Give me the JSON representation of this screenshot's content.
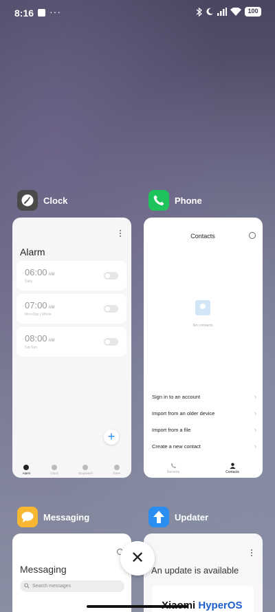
{
  "status_bar": {
    "time": "8:16",
    "more": "···",
    "battery": "100",
    "icons": [
      "bluetooth-icon",
      "moon-icon",
      "signal-icon",
      "wifi-icon",
      "battery-icon"
    ]
  },
  "apps": {
    "clock": {
      "name": "Clock",
      "icon_color": "#4a4a4a",
      "screen_title": "Alarm",
      "alarms": [
        {
          "time": "06:00",
          "ampm": "AM",
          "sub": "Daily"
        },
        {
          "time": "07:00",
          "ampm": "AM",
          "sub": "Mon-Day | Whole"
        },
        {
          "time": "08:00",
          "ampm": "AM",
          "sub": "Sat-Sun"
        }
      ],
      "add": "+",
      "nav": [
        "Alarm",
        "Clock",
        "Stopwatch",
        "Timer"
      ]
    },
    "phone": {
      "name": "Phone",
      "icon_color": "#1fc35b",
      "screen_title": "Contacts",
      "empty_text": "No contacts",
      "menu": [
        "Sign in to an account",
        "Import from an older device",
        "Import from a file",
        "Create a new contact"
      ],
      "nav": [
        "Recents",
        "Contacts"
      ]
    },
    "messaging": {
      "name": "Messaging",
      "icon_color": "#f7b733",
      "screen_title": "Messaging",
      "search_placeholder": "Search messages"
    },
    "updater": {
      "name": "Updater",
      "icon_color": "#2a8ef0",
      "screen_title": "An update is available",
      "logo_a": "Xiaomi ",
      "logo_b": "HyperOS"
    }
  },
  "controls": {
    "close": "✕"
  },
  "colors": {
    "accent": "#2a8ef0",
    "phone_green": "#1fc35b",
    "msg_yellow": "#f7b733"
  }
}
